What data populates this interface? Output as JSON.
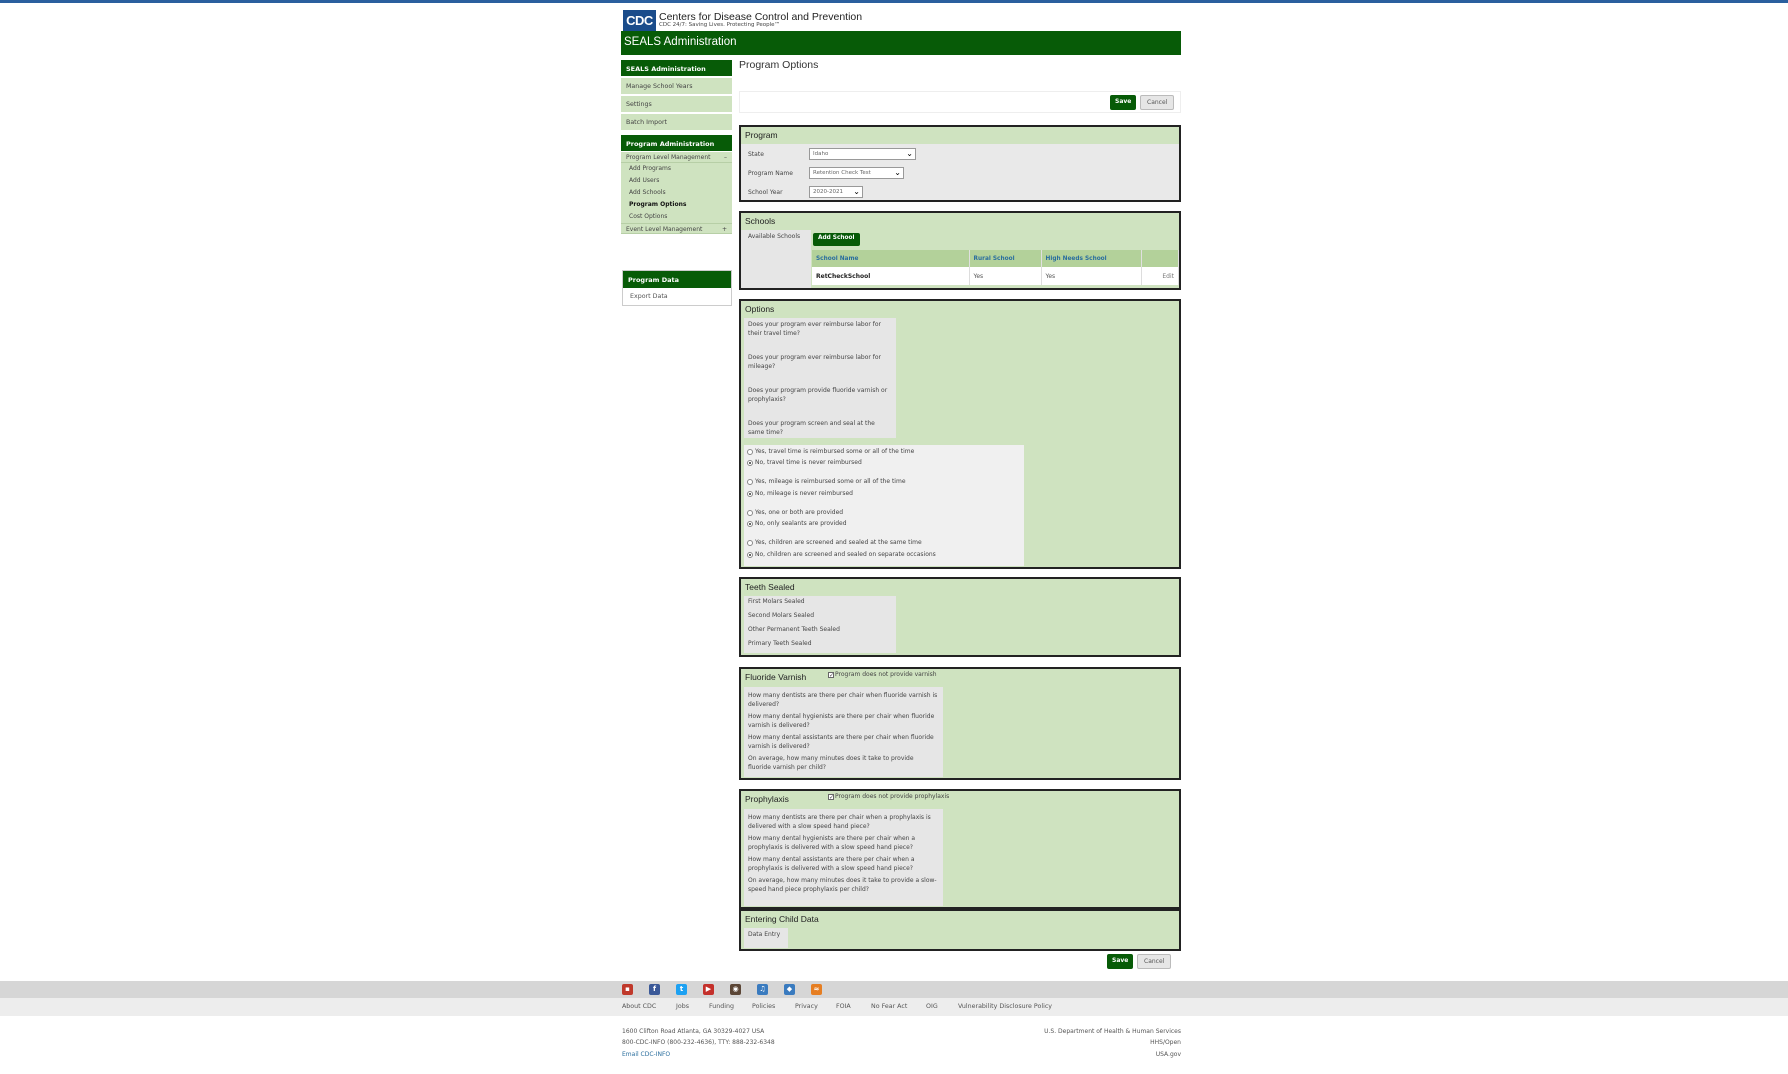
{
  "header": {
    "logo": "CDC",
    "org_name": "Centers for Disease Control and Prevention",
    "tagline": "CDC 24/7: Saving Lives. Protecting People™",
    "app_title": "SEALS Administration"
  },
  "sidebar": {
    "section1_title": "SEALS Administration",
    "items": [
      "Manage School Years",
      "Settings",
      "Batch Import"
    ],
    "section2_title": "Program Administration",
    "program_level": "Program Level Management",
    "program_level_toggle": "–",
    "sub_items": [
      "Add Programs",
      "Add Users",
      "Add Schools",
      "Program Options",
      "Cost Options"
    ],
    "event_level": "Event Level Management",
    "event_level_toggle": "+",
    "program_data_title": "Program Data",
    "export_label": "Export Data"
  },
  "page": {
    "title": "Program Options",
    "save_label": "Save",
    "cancel_label": "Cancel"
  },
  "program": {
    "title": "Program",
    "state_label": "State",
    "state_value": "Idaho",
    "name_label": "Program Name",
    "name_value": "Retention Check Test",
    "year_label": "School Year",
    "year_value": "2020-2021"
  },
  "schools": {
    "title": "Schools",
    "available_label": "Available Schools",
    "add_button": "Add School",
    "columns": [
      "School Name",
      "Rural School",
      "High Needs School",
      ""
    ],
    "rows": [
      {
        "name": "RetCheckSchool",
        "rural": "Yes",
        "high_needs": "Yes",
        "action": "Edit"
      }
    ]
  },
  "options": {
    "title": "Options",
    "questions": [
      "Does your program ever reimburse labor for their travel time?",
      "Does your program ever reimburse labor for mileage?",
      "Does your program provide fluoride varnish or prophylaxis?",
      "Does your program screen and seal at the same time?"
    ],
    "radio_groups": [
      {
        "yes": "Yes, travel time is reimbursed some or all of the time",
        "no": "No, travel time is never reimbursed",
        "selected": "no"
      },
      {
        "yes": "Yes, mileage is reimbursed some or all of the time",
        "no": "No, mileage is never reimbursed",
        "selected": "no"
      },
      {
        "yes": "Yes, one or both are provided",
        "no": "No, only sealants are provided",
        "selected": "no"
      },
      {
        "yes": "Yes, children are screened and sealed at the same time",
        "no": "No, children are screened and sealed on separate occasions",
        "selected": "no"
      }
    ]
  },
  "teeth": {
    "title": "Teeth Sealed",
    "items": [
      "First Molars Sealed",
      "Second Molars Sealed",
      "Other Permanent Teeth Sealed",
      "Primary Teeth Sealed"
    ]
  },
  "varnish": {
    "title": "Fluoride Varnish",
    "checkbox_label": "Program does not provide varnish",
    "checkbox_mark": "✓",
    "questions": [
      "How many dentists are there per chair when fluoride varnish is delivered?",
      "How many dental hygienists are there per chair when fluoride varnish is delivered?",
      "How many dental assistants are there per chair when fluoride varnish is delivered?",
      "On average, how many minutes does it take to provide fluoride varnish per child?"
    ]
  },
  "prophylaxis": {
    "title": "Prophylaxis",
    "checkbox_label": "Program does not provide prophylaxis",
    "checkbox_mark": "✓",
    "questions": [
      "How many dentists are there per chair when a prophylaxis is delivered with a slow speed hand piece?",
      "How many dental hygienists are there per chair when a prophylaxis is delivered with a slow speed hand piece?",
      "How many dental assistants are there per chair when a prophylaxis is delivered with a slow speed hand piece?",
      "On average, how many minutes does it take to provide a slow-speed hand piece prophylaxis per child?"
    ]
  },
  "child_data": {
    "title": "Entering Child Data",
    "label": "Data Entry"
  },
  "footer": {
    "social": [
      {
        "icon": "cdc-widget-icon",
        "glyph": "▪",
        "color": "#c0392b"
      },
      {
        "icon": "facebook-icon",
        "glyph": "f",
        "color": "#3b5998"
      },
      {
        "icon": "twitter-icon",
        "glyph": "t",
        "color": "#1da1f2"
      },
      {
        "icon": "youtube-icon",
        "glyph": "▶",
        "color": "#c4302b"
      },
      {
        "icon": "instagram-icon",
        "glyph": "◉",
        "color": "#5b4636"
      },
      {
        "icon": "podcast-icon",
        "glyph": "♫",
        "color": "#3a7bbf"
      },
      {
        "icon": "syndication-icon",
        "glyph": "◆",
        "color": "#3a7bbf"
      },
      {
        "icon": "rss-icon",
        "glyph": "≈",
        "color": "#e67e22"
      }
    ],
    "links": [
      "About CDC",
      "Jobs",
      "Funding",
      "Policies",
      "Privacy",
      "FOIA",
      "No Fear Act",
      "OIG",
      "Vulnerability Disclosure Policy"
    ],
    "address": "1600 Clifton Road Atlanta, GA 30329-4027 USA",
    "phone": "800-CDC-INFO (800-232-4636), TTY: 888-232-6348",
    "email": "Email CDC-INFO",
    "right": [
      "U.S. Department of Health & Human Services",
      "HHS/Open",
      "USA.gov"
    ]
  }
}
